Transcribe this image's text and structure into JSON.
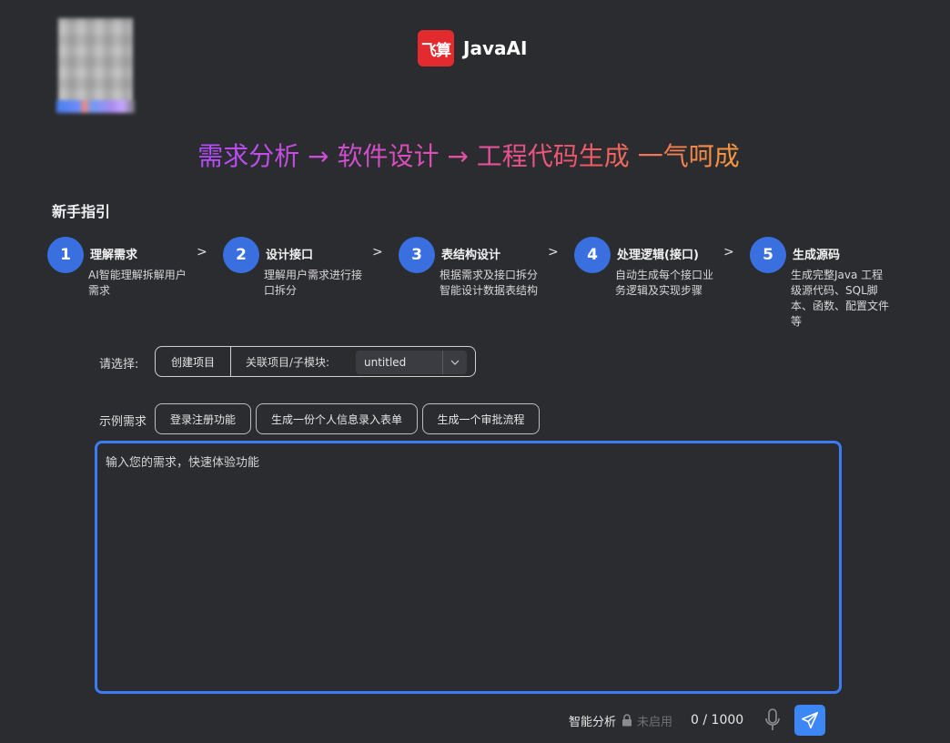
{
  "brand": {
    "logo_text": "飞算",
    "name": "JavaAI"
  },
  "slogan": "需求分析 → 软件设计 → 工程代码生成 一气呵成",
  "guide": {
    "title": "新手指引",
    "separator": ">",
    "steps": [
      {
        "num": "1",
        "title": "理解需求",
        "desc": "AI智能理解拆解用户需求"
      },
      {
        "num": "2",
        "title": "设计接口",
        "desc": "理解用户需求进行接口拆分"
      },
      {
        "num": "3",
        "title": "表结构设计",
        "desc": "根据需求及接口拆分智能设计数据表结构"
      },
      {
        "num": "4",
        "title": "处理逻辑(接口)",
        "desc": "自动生成每个接口业务逻辑及实现步骤"
      },
      {
        "num": "5",
        "title": "生成源码",
        "desc": "生成完整Java 工程级源代码、SQL脚本、函数、配置文件等"
      }
    ]
  },
  "selector": {
    "label": "请选择:",
    "create_button": "创建项目",
    "link_label": "关联项目/子模块:",
    "module_value": "untitled"
  },
  "examples": {
    "label": "示例需求",
    "items": [
      "登录注册功能",
      "生成一份个人信息录入表单",
      "生成一个审批流程"
    ]
  },
  "input": {
    "placeholder": "输入您的需求，快速体验功能",
    "value": ""
  },
  "footer": {
    "smart_analysis": "智能分析",
    "disabled_text": "未启用",
    "counter": "0 / 1000"
  },
  "colors": {
    "background": "#2b2c30",
    "accent": "#3d7bf5",
    "step_circle": "#3a6fe0",
    "logo_red": "#e22a2f"
  },
  "icons": {
    "lock": "lock-icon",
    "mic": "microphone-icon",
    "send": "send-icon",
    "chevron": "chevron-down-icon"
  }
}
